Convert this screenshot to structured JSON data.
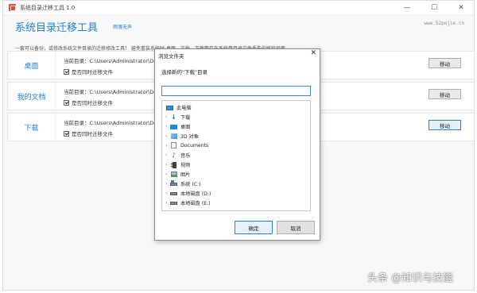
{
  "window": {
    "title": "系统目录迁移工具 1.0",
    "controls": {
      "minimize": "—",
      "maximize": "☐",
      "close": "✕"
    }
  },
  "header": {
    "title": "系统目录迁移工具",
    "subtitle": "雨落无声",
    "url": "www.52pojie.cn",
    "description": "一套可以备份，或修改系统文件目录的迁移修改工具！ 避免重装系统时 桌面，文档，下载等存在系统盘目录文件丢失的尴尬局面......"
  },
  "rows": [
    {
      "label": "桌面",
      "path": "当前目录：C:\\Users\\Administrator\\De",
      "checkbox": "是否同时迁移文件",
      "checked": true,
      "button": "移动"
    },
    {
      "label": "我的文档",
      "path": "当前目录：C:\\Users\\Administrator\\Do",
      "checkbox": "是否同时迁移文件",
      "checked": true,
      "button": "移动"
    },
    {
      "label": "下载",
      "path": "当前目录：C:\\Users\\Administrator\\Do",
      "checkbox": "是否同时迁移文件",
      "checked": true,
      "button": "移动"
    }
  ],
  "dialog": {
    "title": "浏览文件夹",
    "close": "✕",
    "prompt": "选择新的\"下载\"目录",
    "input_value": "",
    "tree": [
      {
        "label": "此电脑",
        "icon": "computer-icon",
        "expandable": false
      },
      {
        "label": "下载",
        "icon": "download-icon",
        "expandable": true
      },
      {
        "label": "桌面",
        "icon": "desktop-icon",
        "expandable": true
      },
      {
        "label": "3D 对象",
        "icon": "3d-objects-icon",
        "expandable": true
      },
      {
        "label": "Documents",
        "icon": "document-icon",
        "expandable": true
      },
      {
        "label": "音乐",
        "icon": "music-icon",
        "expandable": true
      },
      {
        "label": "视频",
        "icon": "video-icon",
        "expandable": true
      },
      {
        "label": "图片",
        "icon": "picture-icon",
        "expandable": true
      },
      {
        "label": "系统 (C:)",
        "icon": "system-drive-icon",
        "expandable": true
      },
      {
        "label": "本地磁盘 (D:)",
        "icon": "drive-icon",
        "expandable": true
      },
      {
        "label": "本地磁盘 (E:)",
        "icon": "drive-icon",
        "expandable": true
      }
    ],
    "ok": "确定",
    "cancel": "取消"
  },
  "watermark": "头条 @知识与技能",
  "colors": {
    "accent": "#1f7fd6",
    "focus_border": "#2f7fd0"
  }
}
